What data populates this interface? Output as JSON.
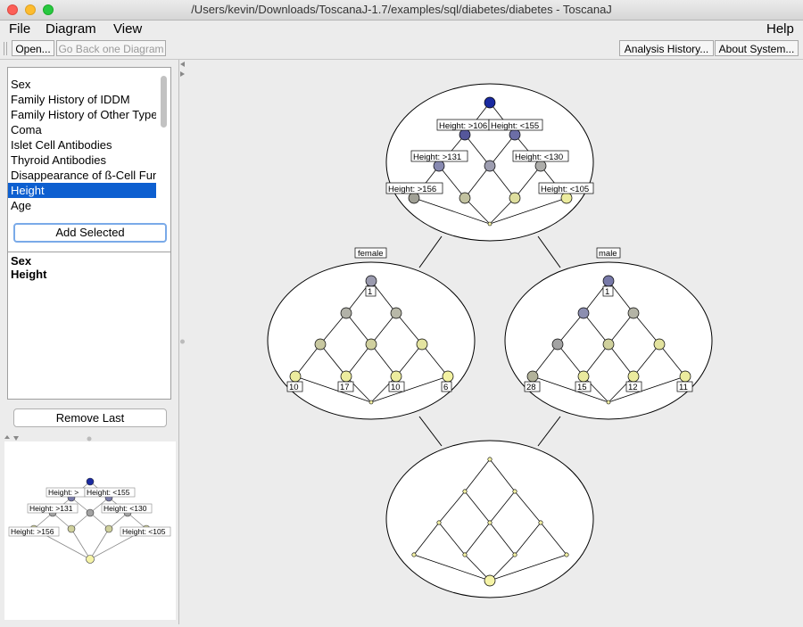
{
  "window": {
    "title": "/Users/kevin/Downloads/ToscanaJ-1.7/examples/sql/diabetes/diabetes - ToscanaJ"
  },
  "menu": {
    "file": "File",
    "diagram": "Diagram",
    "view": "View",
    "help": "Help"
  },
  "toolbar": {
    "open": "Open...",
    "go_back": "Go Back one Diagram",
    "analysis_history": "Analysis History...",
    "about_system": "About System..."
  },
  "attribute_list": {
    "items": [
      {
        "label": "Sex",
        "selected": false
      },
      {
        "label": "Family History of IDDM",
        "selected": false
      },
      {
        "label": "Family History of Other Type",
        "selected": false
      },
      {
        "label": "Coma",
        "selected": false
      },
      {
        "label": "Islet Cell Antibodies",
        "selected": false
      },
      {
        "label": "Thyroid Antibodies",
        "selected": false
      },
      {
        "label": "Disappearance of ß-Cell Fun",
        "selected": false
      },
      {
        "label": "Height",
        "selected": true
      },
      {
        "label": "Age",
        "selected": false
      }
    ]
  },
  "add_selected_label": "Add Selected",
  "selected_list": {
    "items": [
      "Sex",
      "Height"
    ]
  },
  "remove_last_label": "Remove Last",
  "colors": {
    "top_node": "#1a2aa0",
    "mid_node": "#7779a8",
    "gray_node": "#a8a8a8",
    "light_node": "#cfd09c",
    "pale_node": "#f5f3a6",
    "selection": "#0d5fd0"
  },
  "overview_labels": {
    "h106": "Height: >106",
    "h155": "Height: <155",
    "h131": "Height: >131",
    "h130": "Height: <130",
    "h156": "Height: >156",
    "h105": "Height: <105"
  },
  "outer_labels": {
    "female": "female",
    "male": "male"
  },
  "female_counts": {
    "top": "1",
    "a": "10",
    "b": "17",
    "c": "10",
    "d": "6"
  },
  "male_counts": {
    "top": "1",
    "a": "28",
    "b": "15",
    "c": "12",
    "d": "11"
  },
  "mini_labels": {
    "h106": "Height: >",
    "h155": "Height: <155",
    "h131": "Height: >131",
    "h130": "Height: <130",
    "h156": "Height: >156",
    "h105": "Height: <105"
  }
}
